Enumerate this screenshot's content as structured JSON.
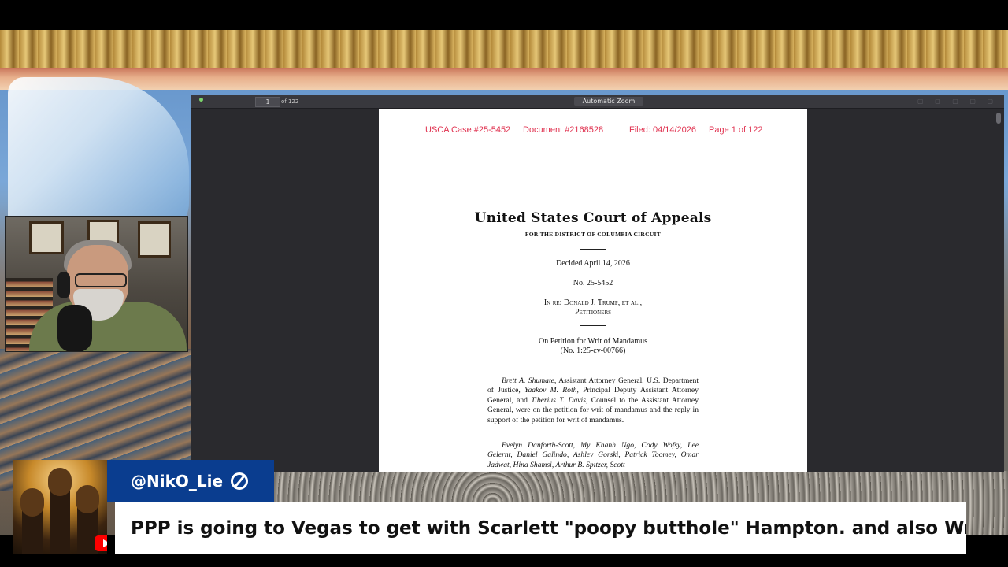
{
  "viewer": {
    "page_input": "1",
    "page_count": "of 122",
    "zoom": "Automatic Zoom"
  },
  "document": {
    "stamp": {
      "case": "USCA Case #25-5452",
      "document": "Document #2168528",
      "filed": "Filed: 04/14/2026",
      "page": "Page 1 of 122"
    },
    "court_title": "United States Court of Appeals",
    "circuit": "FOR THE DISTRICT OF COLUMBIA CIRCUIT",
    "decided": "Decided April 14, 2026",
    "number": "No. 25-5452",
    "in_re_line1": "In re: Donald J. Trump, et al.,",
    "in_re_line2": "Petitioners",
    "petition_line1": "On Petition for Writ of Mandamus",
    "petition_line2": "(No. 1:25-cv-00766)",
    "para1": {
      "n1": "Brett A. Shumate",
      "t1": ", Assistant Attorney General, U.S. Department of Justice, ",
      "n2": "Yaakov M. Roth",
      "t2": ", Principal Deputy Assistant Attorney General, and ",
      "n3": "Tiberius T. Davis",
      "t3": ", Counsel to the Assistant Attorney General, were on the petition for writ of mandamus and the reply in support of the petition for writ of mandamus."
    },
    "para2": {
      "names": "Evelyn Danforth-Scott, My Khanh Ngo, Cody Wofsy, Lee Gelernt, Daniel Galindo, Ashley Gorski, Patrick Toomey, Omar Jadwat, Hina Shamsi, Arthur B. Spitzer, Scott"
    }
  },
  "chat": {
    "username": "@NikO_Lie",
    "message": "PPP is going to Vegas to get with Scarlett \"poopy butthole\" Hampton. and also Wrestlemania"
  },
  "colors": {
    "stamp_red": "#e0314f",
    "name_tag_blue": "#0a3d8f",
    "youtube_red": "#ff0000"
  }
}
